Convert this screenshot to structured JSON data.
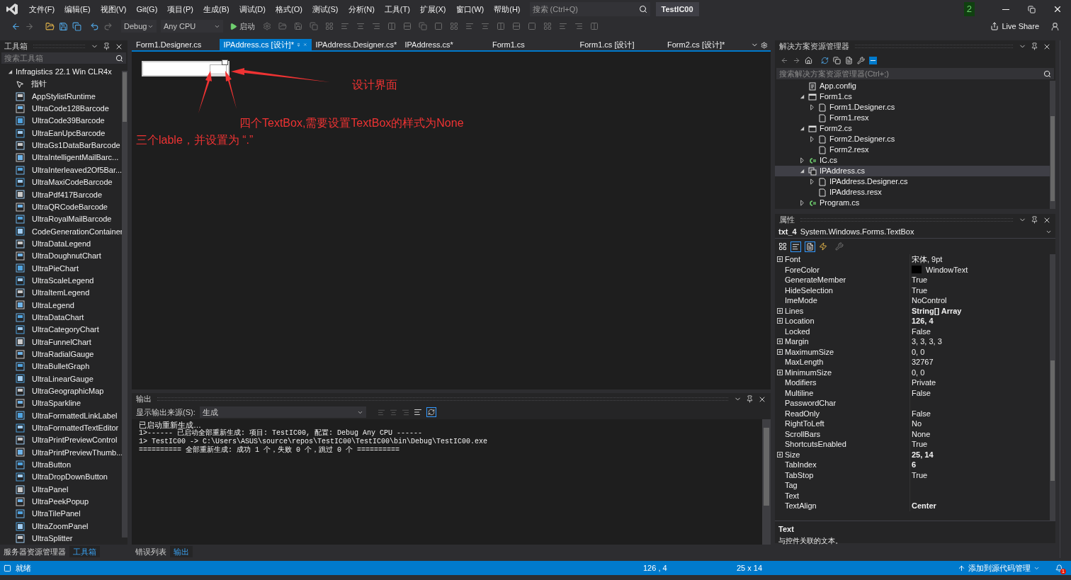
{
  "menu": [
    "文件(F)",
    "编辑(E)",
    "视图(V)",
    "Git(G)",
    "项目(P)",
    "生成(B)",
    "调试(D)",
    "格式(O)",
    "测试(S)",
    "分析(N)",
    "工具(T)",
    "扩展(X)",
    "窗口(W)",
    "帮助(H)"
  ],
  "search": {
    "placeholder": "搜索 (Ctrl+Q)"
  },
  "window": {
    "title": "TestIC00",
    "badge": "2"
  },
  "toolbar": {
    "configuration": "Debug",
    "platform": "Any CPU",
    "start": "启动",
    "live_share": "Live Share"
  },
  "toolbox": {
    "title": "工具箱",
    "search_placeholder": "搜索工具箱",
    "category": "Infragistics 22.1 Win CLR4x",
    "expanded": true,
    "items": [
      "指针",
      "AppStylistRuntime",
      "UltraCode128Barcode",
      "UltraCode39Barcode",
      "UltraEanUpcBarcode",
      "UltraGs1DataBarBarcode",
      "UltraIntelligentMailBarc...",
      "UltraInterleaved2Of5Bar...",
      "UltraMaxiCodeBarcode",
      "UltraPdf417Barcode",
      "UltraQRCodeBarcode",
      "UltraRoyalMailBarcode",
      "CodeGenerationContainer",
      "UltraDataLegend",
      "UltraDoughnutChart",
      "UltraPieChart",
      "UltraScaleLegend",
      "UltraItemLegend",
      "UltraLegend",
      "UltraDataChart",
      "UltraCategoryChart",
      "UltraFunnelChart",
      "UltraRadialGauge",
      "UltraBulletGraph",
      "UltraLinearGauge",
      "UltraGeographicMap",
      "UltraSparkline",
      "UltraFormattedLinkLabel",
      "UltraFormattedTextEditor",
      "UltraPrintPreviewControl",
      "UltraPrintPreviewThumb...",
      "UltraButton",
      "UltraDropDownButton",
      "UltraPanel",
      "UltraPeekPopup",
      "UltraTilePanel",
      "UltraZoomPanel",
      "UltraSplitter"
    ]
  },
  "editor_tabs": [
    {
      "label": "Form1.Designer.cs",
      "selected": false
    },
    {
      "label": "IPAddress.cs [设计]*",
      "selected": true
    },
    {
      "label": "IPAddress.Designer.cs*",
      "selected": false
    },
    {
      "label": "IPAddress.cs*",
      "selected": false
    },
    {
      "label": "Form1.cs",
      "selected": false
    },
    {
      "label": "Form1.cs [设计]",
      "selected": false
    },
    {
      "label": "Form2.cs [设计]*",
      "selected": false
    }
  ],
  "annotations": [
    "设计界面",
    "四个TextBox,需要设置TextBox的样式为None",
    "三个lable，并设置为 “.”"
  ],
  "output": {
    "title": "输出",
    "source_label": "显示输出来源(S):",
    "source": "生成",
    "lines": [
      "已启动重新生成…",
      "1>------ 已启动全部重新生成: 项目: TestIC00, 配置: Debug Any CPU ------",
      "1>  TestIC00 -> C:\\Users\\ASUS\\source\\repos\\TestIC00\\TestIC00\\bin\\Debug\\TestIC00.exe",
      "========== 全部重新生成: 成功 1 个，失败 0 个，跳过 0 个 =========="
    ]
  },
  "solution_explorer": {
    "title": "解决方案资源管理器",
    "search_placeholder": "搜索解决方案资源管理器(Ctrl+;)",
    "items": [
      {
        "label": "App.config",
        "kind": "config",
        "selected": false
      },
      {
        "label": "Form1.cs",
        "kind": "form",
        "selected": false,
        "expanded": true,
        "children": [
          {
            "label": "Form1.Designer.cs",
            "kind": "file",
            "selected": false,
            "expanded": false
          },
          {
            "label": "Form1.resx",
            "kind": "file",
            "selected": false
          }
        ]
      },
      {
        "label": "Form2.cs",
        "kind": "form",
        "selected": false,
        "expanded": true,
        "children": [
          {
            "label": "Form2.Designer.cs",
            "kind": "file",
            "selected": false,
            "expanded": false
          },
          {
            "label": "Form2.resx",
            "kind": "file",
            "selected": false
          }
        ]
      },
      {
        "label": "IC.cs",
        "kind": "csharp",
        "selected": false,
        "expanded": false
      },
      {
        "label": "IPAddress.cs",
        "kind": "control",
        "selected": true,
        "expanded": true,
        "children": [
          {
            "label": "IPAddress.Designer.cs",
            "kind": "file",
            "selected": false,
            "expanded": false
          },
          {
            "label": "IPAddress.resx",
            "kind": "file",
            "selected": false
          }
        ]
      },
      {
        "label": "Program.cs",
        "kind": "csharp",
        "selected": false,
        "expanded": false
      }
    ]
  },
  "properties": {
    "title": "属性",
    "object_name": "txt_4",
    "object_type": "System.Windows.Forms.TextBox",
    "rows": [
      {
        "name": "Font",
        "value": "宋体, 9pt",
        "expandable": true,
        "bold": false
      },
      {
        "name": "ForeColor",
        "value": "WindowText",
        "expandable": false,
        "bold": false,
        "color": "#000000"
      },
      {
        "name": "GenerateMember",
        "value": "True",
        "expandable": false,
        "bold": false
      },
      {
        "name": "HideSelection",
        "value": "True",
        "expandable": false,
        "bold": false
      },
      {
        "name": "ImeMode",
        "value": "NoControl",
        "expandable": false,
        "bold": false
      },
      {
        "name": "Lines",
        "value": "String[] Array",
        "expandable": true,
        "bold": true
      },
      {
        "name": "Location",
        "value": "126, 4",
        "expandable": true,
        "bold": true
      },
      {
        "name": "Locked",
        "value": "False",
        "expandable": false,
        "bold": false
      },
      {
        "name": "Margin",
        "value": "3, 3, 3, 3",
        "expandable": true,
        "bold": false
      },
      {
        "name": "MaximumSize",
        "value": "0, 0",
        "expandable": true,
        "bold": false
      },
      {
        "name": "MaxLength",
        "value": "32767",
        "expandable": false,
        "bold": false
      },
      {
        "name": "MinimumSize",
        "value": "0, 0",
        "expandable": true,
        "bold": false
      },
      {
        "name": "Modifiers",
        "value": "Private",
        "expandable": false,
        "bold": false
      },
      {
        "name": "Multiline",
        "value": "False",
        "expandable": false,
        "bold": false
      },
      {
        "name": "PasswordChar",
        "expandable": false
      },
      {
        "name": "ReadOnly",
        "value": "False",
        "expandable": false,
        "bold": false
      },
      {
        "name": "RightToLeft",
        "value": "No",
        "expandable": false,
        "bold": false
      },
      {
        "name": "ScrollBars",
        "value": "None",
        "expandable": false,
        "bold": false
      },
      {
        "name": "ShortcutsEnabled",
        "value": "True",
        "expandable": false,
        "bold": false
      },
      {
        "name": "Size",
        "value": "25, 14",
        "expandable": true,
        "bold": true
      },
      {
        "name": "TabIndex",
        "value": "6",
        "expandable": false,
        "bold": true
      },
      {
        "name": "TabStop",
        "value": "True",
        "expandable": false,
        "bold": false
      },
      {
        "name": "Tag",
        "expandable": false
      },
      {
        "name": "Text",
        "expandable": false
      },
      {
        "name": "TextAlign",
        "value": "Center",
        "expandable": false,
        "bold": true
      }
    ],
    "description_title": "Text",
    "description": "与控件关联的文本。"
  },
  "left_bottom_tabs": [
    {
      "label": "服务器资源管理器",
      "selected": false
    },
    {
      "label": "工具箱",
      "selected": true
    }
  ],
  "output_bottom_tabs": [
    {
      "label": "错误列表",
      "selected": false
    },
    {
      "label": "输出",
      "selected": true
    }
  ],
  "status_bar": {
    "state": "就绪",
    "position": "126 , 4",
    "size": "25 x 14",
    "source_control": "添加到源代码管理",
    "notifications": "1"
  }
}
